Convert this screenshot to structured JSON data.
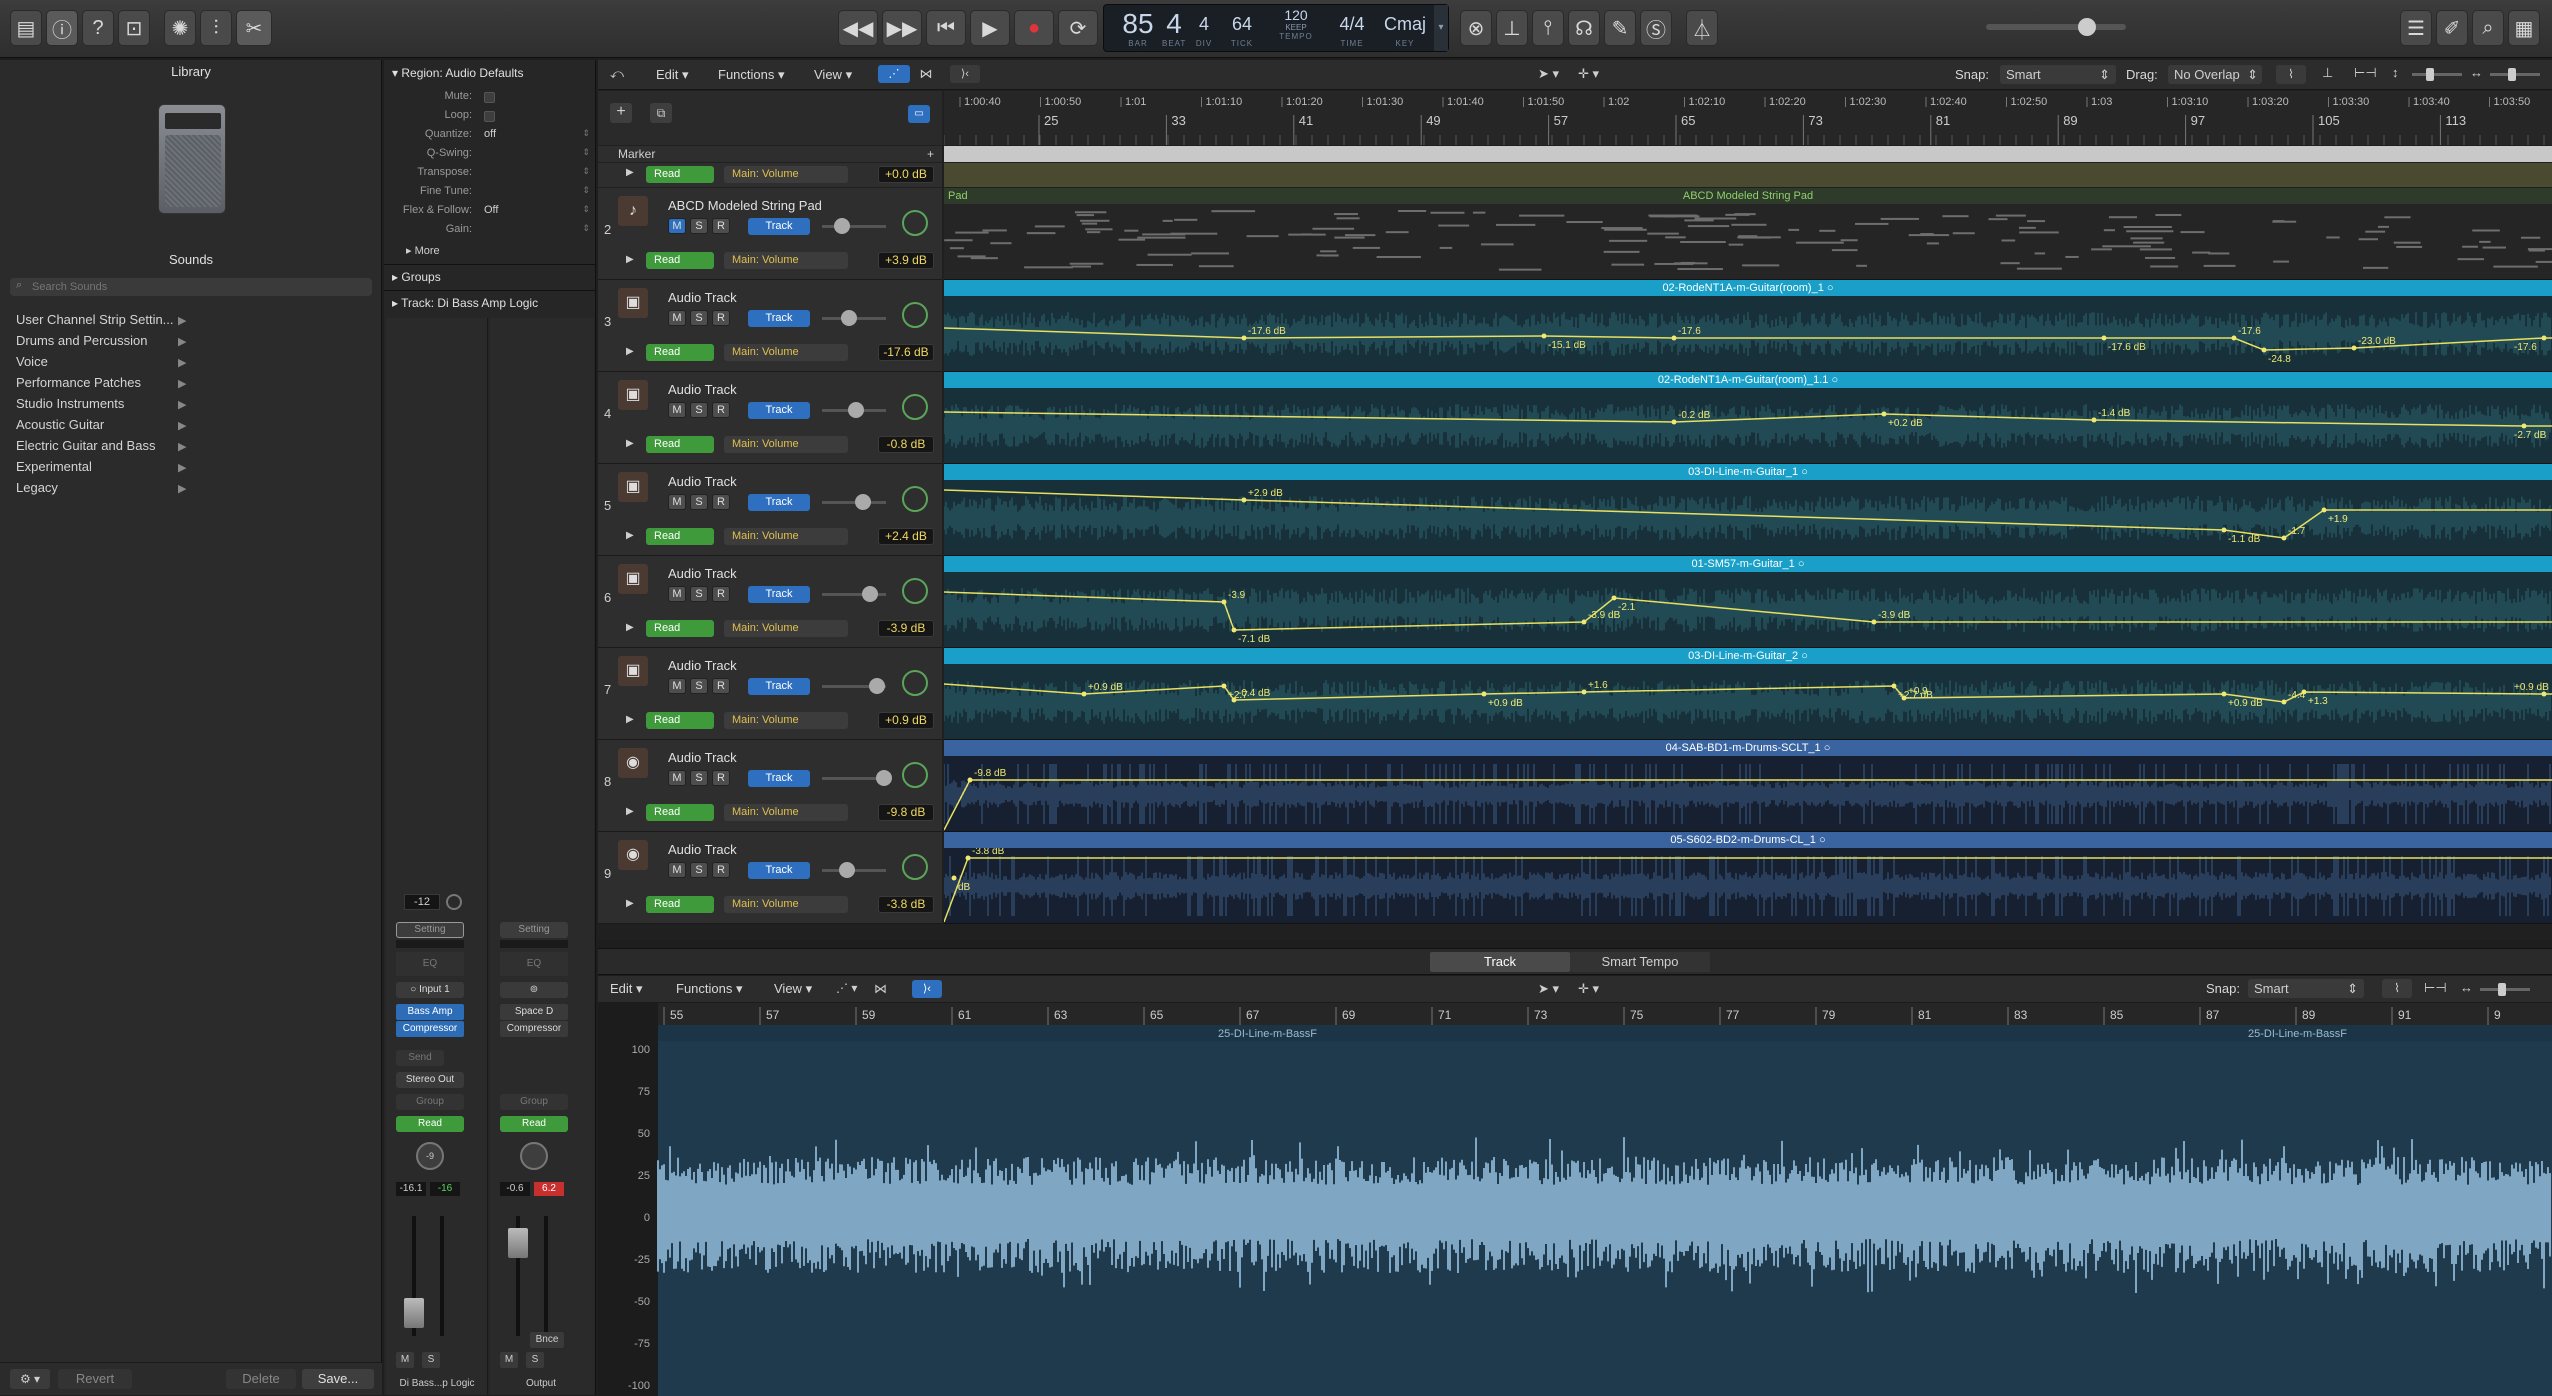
{
  "toolbar": {
    "lcd": {
      "bar": "85",
      "beat": "4",
      "div": "4",
      "tick": "64",
      "tempo": "120",
      "tempo_sub": "KEEP",
      "time_sig": "4/4",
      "key": "Cmaj",
      "labels": {
        "bar": "BAR",
        "beat": "BEAT",
        "div": "DIV",
        "tick": "TICK",
        "tempo": "TEMPO",
        "time": "TIME",
        "key": "KEY"
      }
    }
  },
  "library": {
    "title": "Library",
    "sounds_label": "Sounds",
    "search_placeholder": "Search Sounds",
    "items": [
      "User Channel Strip Settin...",
      "Drums and Percussion",
      "Voice",
      "Performance Patches",
      "Studio Instruments",
      "Acoustic Guitar",
      "Electric Guitar and Bass",
      "Experimental",
      "Legacy"
    ],
    "revert": "Revert",
    "delete": "Delete",
    "save": "Save..."
  },
  "inspector": {
    "region_label": "Region:",
    "region_name": "Audio Defaults",
    "rows": [
      {
        "k": "Mute:",
        "v": ""
      },
      {
        "k": "Loop:",
        "v": ""
      },
      {
        "k": "Quantize:",
        "v": "off"
      },
      {
        "k": "Q-Swing:",
        "v": ""
      },
      {
        "k": "Transpose:",
        "v": ""
      },
      {
        "k": "Fine Tune:",
        "v": ""
      },
      {
        "k": "Flex & Follow:",
        "v": "Off"
      },
      {
        "k": "Gain:",
        "v": ""
      }
    ],
    "more": "More",
    "groups": "Groups",
    "track_label": "Track:",
    "track_name": "Di  Bass Amp  Logic",
    "strip1": {
      "value": "-12",
      "setting": "Setting",
      "eq": "EQ",
      "input": "Input 1",
      "plugin1": "Bass Amp",
      "plugin2": "Compressor",
      "send": "Send",
      "output": "Stereo Out",
      "group": "Group",
      "read": "Read",
      "pan": "-9",
      "vol": "-16.1",
      "peak": "-16",
      "name": "Di  Bass...p  Logic"
    },
    "strip2": {
      "setting": "Setting",
      "eq": "EQ",
      "plugin1": "Space D",
      "plugin2": "Compressor",
      "group": "Group",
      "read": "Read",
      "vol": "-0.6",
      "peak": "6.2",
      "bnce": "Bnce",
      "name": "Output"
    },
    "m": "M",
    "s": "S"
  },
  "main": {
    "menu": {
      "edit": "Edit",
      "functions": "Functions",
      "view": "View"
    },
    "snap_label": "Snap:",
    "snap_value": "Smart",
    "drag_label": "Drag:",
    "drag_value": "No Overlap",
    "marker": "Marker",
    "ruler_times": [
      "1:00:40",
      "1:00:50",
      "1:01",
      "1:01:10",
      "1:01:20",
      "1:01:30",
      "1:01:40",
      "1:01:50",
      "1:02",
      "1:02:10",
      "1:02:20",
      "1:02:30",
      "1:02:40",
      "1:02:50",
      "1:03",
      "1:03:10",
      "1:03:20",
      "1:03:30",
      "1:03:40",
      "1:03:50"
    ],
    "ruler_bars": [
      "25",
      "33",
      "41",
      "49",
      "57",
      "65",
      "73",
      "81",
      "89",
      "97",
      "105",
      "113"
    ],
    "top_track": {
      "read": "Read",
      "vol": "Main: Volume",
      "db": "+0.0 dB"
    },
    "tracks": [
      {
        "num": "2",
        "name": "ABCD Modeled String Pad",
        "db": "+3.9 dB",
        "region": "ABCD Modeled String Pad",
        "region_left": "Pad",
        "midi": true,
        "automation": []
      },
      {
        "num": "3",
        "name": "Audio Track",
        "db": "-17.6 dB",
        "region": "02-RodeNT1A-m-Guitar(room)_1",
        "automation": [
          "-17.6 dB",
          "-15.1 dB",
          "-17.6",
          "-17.6 dB",
          "-17.6",
          "-24.8",
          "-23.0 dB",
          "-17.6"
        ]
      },
      {
        "num": "4",
        "name": "Audio Track",
        "db": "-0.8 dB",
        "region": "02-RodeNT1A-m-Guitar(room)_1.1",
        "automation": [
          "-0.2 dB",
          "+0.2 dB",
          "-1.4 dB",
          "-2.7 dB"
        ]
      },
      {
        "num": "5",
        "name": "Audio Track",
        "db": "+2.4 dB",
        "region": "03-DI-Line-m-Guitar_1",
        "automation": [
          "+2.9 dB",
          "-1.1 dB",
          "-1.7",
          "+1.9"
        ]
      },
      {
        "num": "6",
        "name": "Audio Track",
        "db": "-3.9 dB",
        "region": "01-SM57-m-Guitar_1",
        "automation": [
          "-3.9",
          "-7.1 dB",
          "-3.9 dB",
          "-2.1",
          "-3.9 dB"
        ]
      },
      {
        "num": "7",
        "name": "Audio Track",
        "db": "+0.9 dB",
        "region": "03-DI-Line-m-Guitar_2",
        "automation": [
          "+0.9 dB",
          "+2.7",
          "-0.4 dB",
          "+0.9 dB",
          "+1.6",
          "+2.7 dB",
          "+0.9",
          "+0.9 dB",
          "-4.4",
          "+1.3",
          "+0.9 dB"
        ]
      },
      {
        "num": "8",
        "name": "Audio Track",
        "db": "-9.8 dB",
        "region": "04-SAB-BD1-m-Drums-SCLT_1",
        "automation": [
          "-9.8 dB"
        ],
        "drums": true
      },
      {
        "num": "9",
        "name": "Audio Track",
        "db": "-3.8 dB",
        "region": "05-S602-BD2-m-Drums-CL_1",
        "automation": [
          "-3.8 dB",
          "dB"
        ],
        "drums": true
      }
    ],
    "m": "M",
    "s": "S",
    "r": "R",
    "read": "Read",
    "track_btn": "Track",
    "vol": "Main: Volume"
  },
  "editor": {
    "tabs": [
      "Track",
      "Smart Tempo"
    ],
    "menu": {
      "edit": "Edit",
      "functions": "Functions",
      "view": "View"
    },
    "snap_label": "Snap:",
    "snap_value": "Smart",
    "ruler": [
      "55",
      "57",
      "59",
      "61",
      "63",
      "65",
      "67",
      "69",
      "71",
      "73",
      "75",
      "77",
      "79",
      "81",
      "83",
      "85",
      "87",
      "89",
      "91",
      "9"
    ],
    "region_name": "25-DI-Line-m-BassF",
    "y_labels": [
      "100",
      "75",
      "50",
      "25",
      "0",
      "-25",
      "-50",
      "-75",
      "-100"
    ]
  }
}
